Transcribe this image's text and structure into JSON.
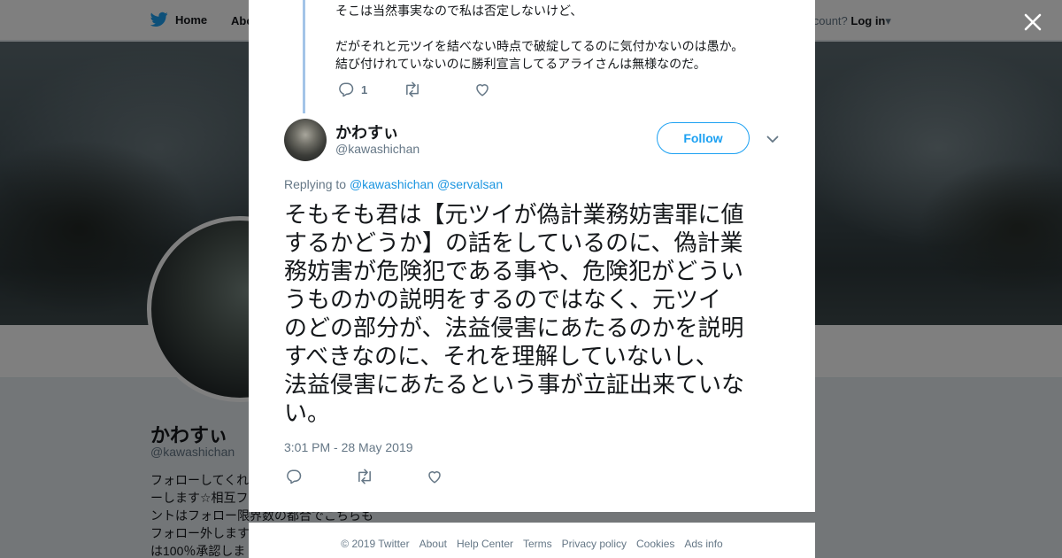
{
  "nav": {
    "home_label": "Home",
    "about_label": "Abo",
    "account_prompt": "account?",
    "login_label": "Log in"
  },
  "profile": {
    "name": "かわすぃ",
    "handle": "@kawashichan",
    "bio_lines": [
      "フォローしてくれ",
      "ーします☆相互フ",
      "ントはフォロー限界数の都合でこちらも",
      "フォロー外します",
      "は100％承認しま"
    ]
  },
  "previous_tweet": {
    "lines": [
      "そこは当然事実なので私は否定しないけど、",
      "",
      "だがそれと元ツイを結べない時点で破綻してるのに気付かないのは愚か。",
      "結び付けれていないのに勝利宣言してるアライさんは無様なのだ。"
    ],
    "reply_count": "1"
  },
  "tweet": {
    "author_name": "かわすぃ",
    "author_handle": "@kawashichan",
    "follow_label": "Follow",
    "replying_prefix": "Replying to",
    "reply_targets": [
      "@kawashichan",
      "@servalsan"
    ],
    "text_lines": [
      "そもそも君は【元ツイが偽計業務妨害罪に値",
      "するかどうか】の話をしているのに、偽計業",
      "務妨害が危険犯である事や、危険犯がどうい",
      "うものかの説明をするのではなく、元ツイ",
      "のどの部分が、法益侵害にあたるのかを説明",
      "すべきなのに、それを理解していないし、",
      "法益侵害にあたるという事が立証出来ていな",
      "い。"
    ],
    "timestamp": "3:01 PM - 28 May 2019"
  },
  "footer": {
    "links": [
      "© 2019 Twitter",
      "About",
      "Help Center",
      "Terms",
      "Privacy policy",
      "Cookies",
      "Ads info"
    ]
  },
  "icons": {
    "brand": "twitter-bird-icon",
    "close": "close-icon",
    "reply": "reply-icon",
    "retweet": "retweet-icon",
    "like": "heart-icon",
    "more": "chevron-down-icon"
  },
  "colors": {
    "accent": "#1da1f2",
    "link": "#1b95e0",
    "text": "#14171a",
    "muted": "#657786",
    "thread_line": "#a3c4e8"
  }
}
